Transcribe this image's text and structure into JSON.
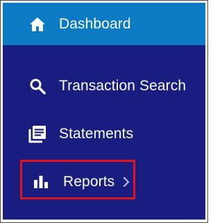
{
  "nav": {
    "items": [
      {
        "label": "Dashboard",
        "icon": "home-icon",
        "active": true
      },
      {
        "label": "Transaction Search",
        "icon": "search-icon"
      },
      {
        "label": "Statements",
        "icon": "statements-icon"
      },
      {
        "label": "Reports",
        "icon": "bar-chart-icon",
        "submenu_icon": "chevron-right-icon",
        "highlighted": true
      }
    ]
  },
  "colors": {
    "nav_background": "#1a1d80",
    "active_background": "#0c7bc3",
    "text": "#ffffff",
    "highlight_border": "#e0141e",
    "chevron": "#b9bcd6"
  }
}
